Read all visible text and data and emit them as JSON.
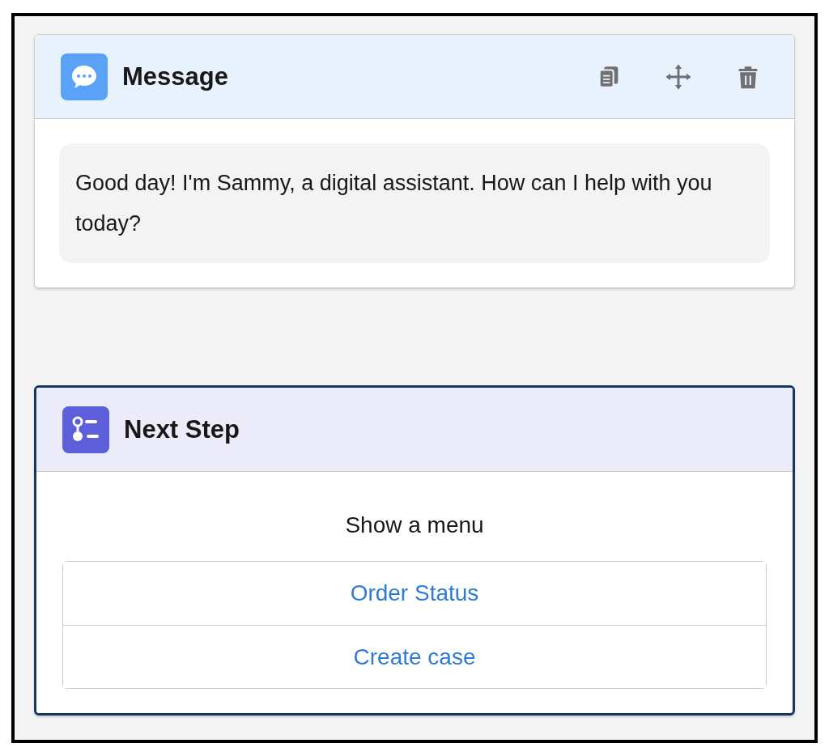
{
  "cards": [
    {
      "kind": "message",
      "title": "Message",
      "selected": false,
      "actions": [
        {
          "kind": "copy"
        },
        {
          "kind": "move"
        },
        {
          "kind": "delete"
        }
      ],
      "text": "Good day! I'm Sammy, a digital assistant. How can I help with you today?"
    },
    {
      "kind": "menu",
      "title": "Next Step",
      "selected": true,
      "caption": "Show a menu",
      "options": [
        "Order Status",
        "Create case"
      ]
    }
  ]
}
